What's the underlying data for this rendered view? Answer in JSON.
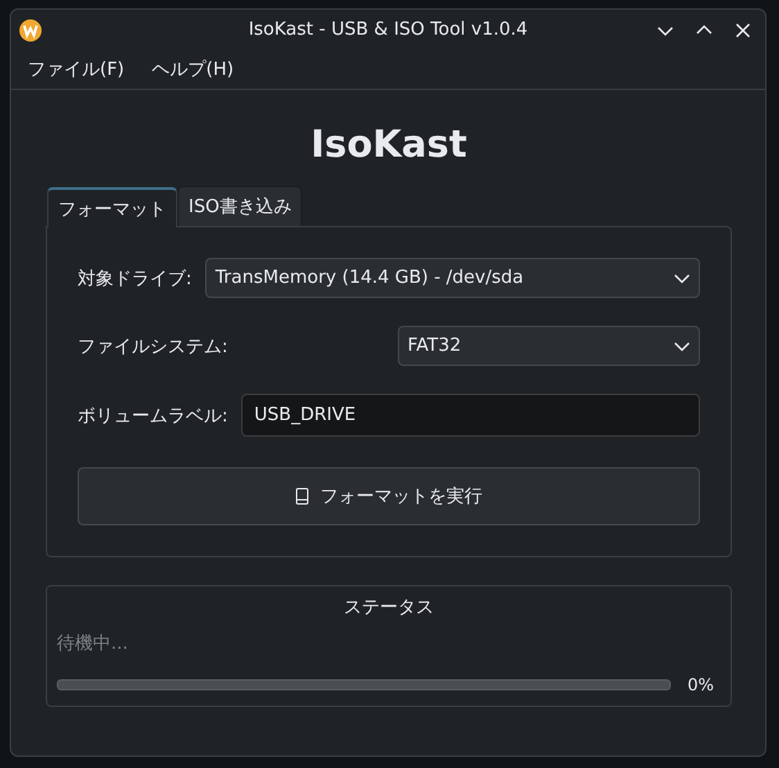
{
  "window": {
    "title": "IsoKast - USB & ISO Tool v1.0.4"
  },
  "menu": [
    "ファイル(F)",
    "ヘルプ(H)"
  ],
  "app_title": "IsoKast",
  "tabs": [
    {
      "label": "フォーマット",
      "selected": true
    },
    {
      "label": "ISO書き込み",
      "selected": false
    }
  ],
  "drive": {
    "label": "対象ドライブ:",
    "value": "TransMemory (14.4 GB) - /dev/sda"
  },
  "filesystem": {
    "label": "ファイルシステム:",
    "value": "FAT32"
  },
  "volume_label": {
    "label": "ボリュームラベル:",
    "value": "USB_DRIVE"
  },
  "format_button": "フォーマットを実行",
  "status": {
    "title": "ステータス",
    "message": "待機中...",
    "level": 0,
    "reading": "0%"
  }
}
